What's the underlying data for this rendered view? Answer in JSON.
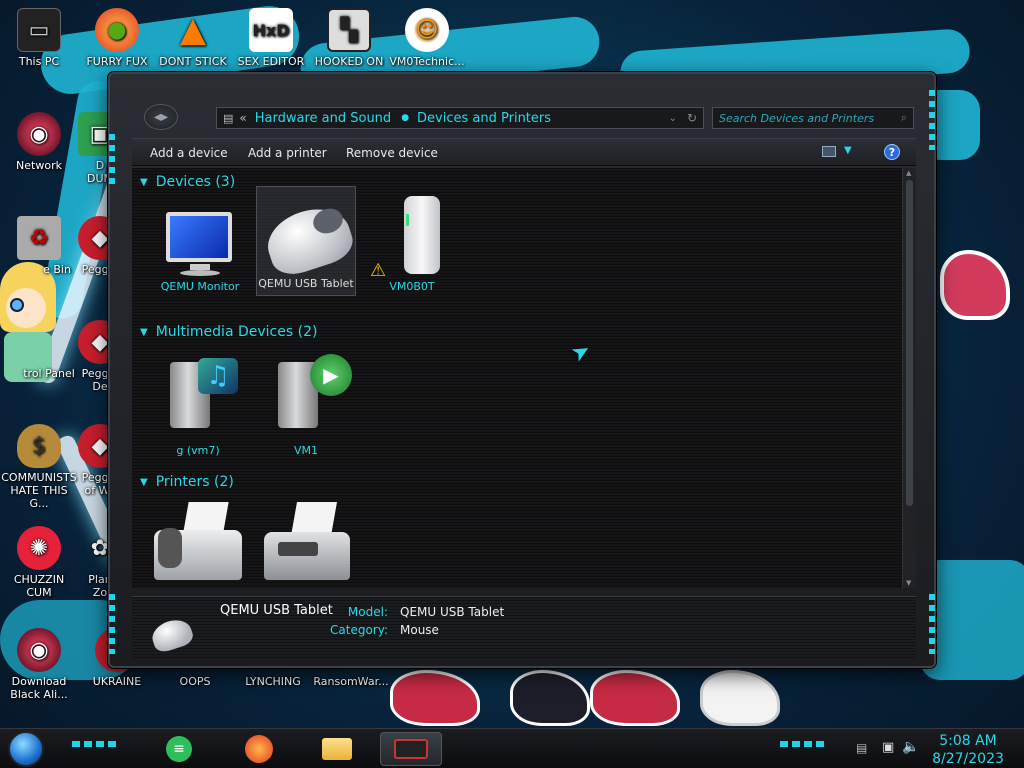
{
  "desktop": {
    "icons": [
      {
        "label": "This PC",
        "icon": "computer-icon"
      },
      {
        "label": "FURRY FUX",
        "icon": "firefox-icon"
      },
      {
        "label": "DONT STICK",
        "icon": "vlc-cone-icon"
      },
      {
        "label": "SEX EDITOR",
        "icon": "hex-editor-icon"
      },
      {
        "label": "HOOKED ON",
        "icon": "maze-icon"
      },
      {
        "label": "VM0Technic...",
        "icon": "doctor-icon"
      },
      {
        "label": "Network",
        "icon": "network-icon"
      },
      {
        "label": "D\nDUM",
        "icon": "app-icon"
      },
      {
        "label": "e Bin",
        "icon": "recycle-bin-icon"
      },
      {
        "label": "Peggle",
        "icon": "peggle-icon"
      },
      {
        "label": "trol Panel",
        "icon": "control-panel-icon"
      },
      {
        "label": "Peggle\nDe",
        "icon": "peggle-icon"
      },
      {
        "label": "COMMUNISTS\nHATE THIS G...",
        "icon": "money-bag-icon"
      },
      {
        "label": "Peggle\nof Wa",
        "icon": "peggle-icon"
      },
      {
        "label": "CHUZZIN\nCUM",
        "icon": "chuzzle-icon"
      },
      {
        "label": "Plan\nZo",
        "icon": "flower-icon"
      },
      {
        "label": "Download\nBlack Ali...",
        "icon": "alien-icon"
      },
      {
        "label": "UKRAINE",
        "icon": "app-icon"
      },
      {
        "label": "OOPS",
        "icon": "app-icon"
      },
      {
        "label": "LYNCHING",
        "icon": "app-icon"
      },
      {
        "label": "RansomWar...",
        "icon": "app-icon"
      }
    ]
  },
  "window": {
    "breadcrumb": {
      "overflow": "«",
      "segments": [
        "Hardware and Sound",
        "Devices and Printers"
      ]
    },
    "search": {
      "placeholder": "Search Devices and Printers"
    },
    "toolbar": {
      "add_device": "Add a device",
      "add_printer": "Add a printer",
      "remove_device": "Remove device"
    },
    "groups": {
      "devices": {
        "header": "Devices (3)",
        "items": [
          {
            "label": "QEMU Monitor",
            "icon": "monitor-icon"
          },
          {
            "label": "QEMU USB Tablet",
            "icon": "mouse-icon",
            "selected": true
          },
          {
            "label": "VM0B0T",
            "icon": "external-drive-icon",
            "warning": true
          }
        ]
      },
      "multimedia": {
        "header": "Multimedia Devices (2)",
        "items": [
          {
            "label": "g (vm7)",
            "icon": "media-server-icon"
          },
          {
            "label": "VM1",
            "icon": "media-player-icon"
          }
        ]
      },
      "printers": {
        "header": "Printers (2)",
        "items": [
          {
            "label": "",
            "icon": "fax-icon"
          },
          {
            "label": "",
            "icon": "printer-icon"
          }
        ]
      }
    },
    "details": {
      "name": "QEMU USB Tablet",
      "model_label": "Model:",
      "model_value": "QEMU USB Tablet",
      "category_label": "Category:",
      "category_value": "Mouse"
    }
  },
  "taskbar": {
    "apps": [
      {
        "name": "notes",
        "icon": "notes-icon"
      },
      {
        "name": "firefox",
        "icon": "firefox-icon"
      },
      {
        "name": "explorer",
        "icon": "folder-icon"
      },
      {
        "name": "control-panel",
        "icon": "devices-icon",
        "active": true
      }
    ],
    "time": "5:08 AM",
    "date": "8/27/2023"
  },
  "colors": {
    "accent": "#28d8e8",
    "window_bg": "#151517",
    "help_blue": "#2d6bd8"
  }
}
